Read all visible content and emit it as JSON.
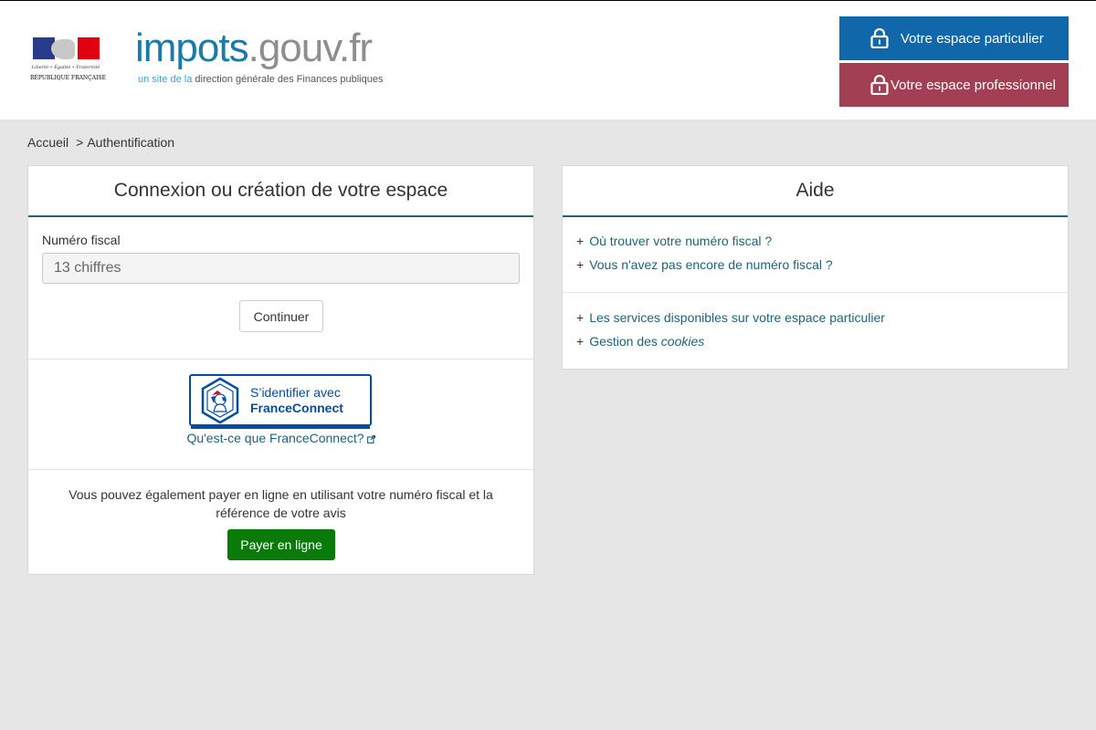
{
  "header": {
    "republic": {
      "motto": "Liberté • Égalité • Fraternité",
      "name": "RÉPUBLIQUE FRANÇAISE"
    },
    "site_logo": {
      "part1": "impots",
      "part2": ".gouv.fr",
      "tagline_a": "un site de la",
      "tagline_b": "direction générale des Finances publiques"
    },
    "buttons": {
      "particulier": "Votre espace particulier",
      "professionnel": "Votre espace professionnel"
    },
    "colors": {
      "particulier_bg": "#1067a9",
      "professionnel_bg": "#a33f53"
    }
  },
  "breadcrumb": {
    "home": "Accueil",
    "separator": ">",
    "current": "Authentification"
  },
  "login_card": {
    "title": "Connexion ou création de votre espace",
    "fiscal_label": "Numéro fiscal",
    "fiscal_placeholder": "13 chiffres",
    "fiscal_value": "",
    "continue_label": "Continuer",
    "franceconnect": {
      "line1": "S’identifier avec",
      "line2": "FranceConnect",
      "info_link": "Qu'est-ce que FranceConnect?"
    },
    "payment_text": "Vous pouvez également payer en ligne en utilisant votre numéro fiscal et la référence de votre avis",
    "pay_button": "Payer en ligne",
    "colors": {
      "pay_bg": "#0a7a0a",
      "accent": "#1e6377"
    }
  },
  "help_card": {
    "title": "Aide",
    "group1": [
      "Où trouver votre numéro fiscal ?",
      "Vous n'avez pas encore de numéro fiscal ?"
    ],
    "group2": [
      "Les services disponibles sur votre espace particulier"
    ],
    "cookies": {
      "prefix": "Gestion des",
      "emph": "cookies"
    },
    "plus_symbol": "+"
  },
  "icons": {
    "lock": "lock-icon",
    "external": "external-link-icon",
    "marianne": "marianne-logo",
    "franceconnect": "franceconnect-logo"
  }
}
